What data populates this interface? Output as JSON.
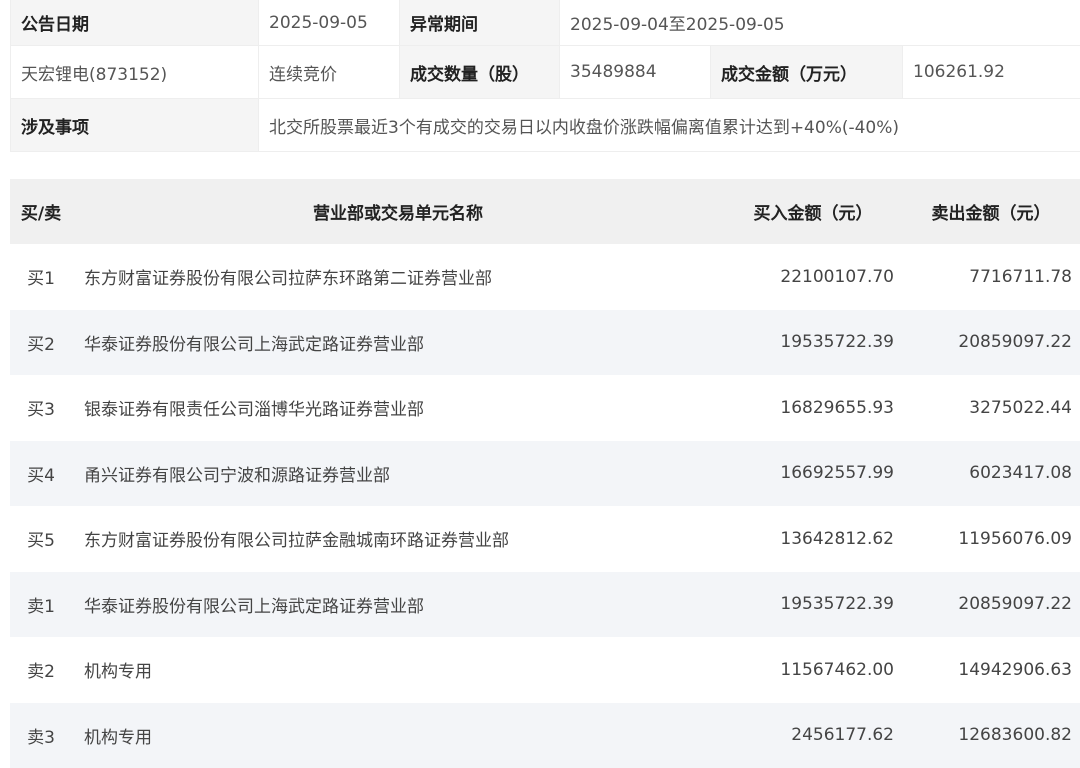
{
  "info": {
    "announce_date_label": "公告日期",
    "announce_date": "2025-09-05",
    "abnormal_period_label": "异常期间",
    "abnormal_period": "2025-09-04至2025-09-05",
    "stock": "天宏锂电(873152)",
    "trade_type": "连续竞价",
    "volume_label": "成交数量（股）",
    "volume": "35489884",
    "amount_label": "成交金额（万元）",
    "amount": "106261.92",
    "matter_label": "涉及事项",
    "matter": "北交所股票最近3个有成交的交易日以内收盘价涨跌幅偏离值累计达到+40%(-40%)"
  },
  "trade_table": {
    "headers": {
      "side": "买/卖",
      "name": "营业部或交易单元名称",
      "buy": "买入金额（元）",
      "sell": "卖出金额（元）"
    },
    "rows": [
      {
        "side": "买1",
        "name": "东方财富证券股份有限公司拉萨东环路第二证券营业部",
        "buy": "22100107.70",
        "sell": "7716711.78"
      },
      {
        "side": "买2",
        "name": "华泰证券股份有限公司上海武定路证券营业部",
        "buy": "19535722.39",
        "sell": "20859097.22"
      },
      {
        "side": "买3",
        "name": "银泰证券有限责任公司淄博华光路证券营业部",
        "buy": "16829655.93",
        "sell": "3275022.44"
      },
      {
        "side": "买4",
        "name": "甬兴证券有限公司宁波和源路证券营业部",
        "buy": "16692557.99",
        "sell": "6023417.08"
      },
      {
        "side": "买5",
        "name": "东方财富证券股份有限公司拉萨金融城南环路证券营业部",
        "buy": "13642812.62",
        "sell": "11956076.09"
      },
      {
        "side": "卖1",
        "name": "华泰证券股份有限公司上海武定路证券营业部",
        "buy": "19535722.39",
        "sell": "20859097.22"
      },
      {
        "side": "卖2",
        "name": "机构专用",
        "buy": "11567462.00",
        "sell": "14942906.63"
      },
      {
        "side": "卖3",
        "name": "机构专用",
        "buy": "2456177.62",
        "sell": "12683600.82"
      }
    ]
  }
}
